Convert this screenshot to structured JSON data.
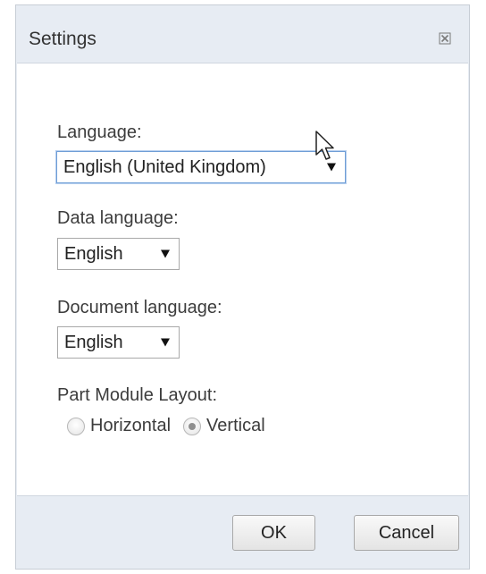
{
  "dialog": {
    "title": "Settings"
  },
  "fields": {
    "language": {
      "label": "Language:",
      "value": "English (United Kingdom)"
    },
    "data_language": {
      "label": "Data language:",
      "value": "English"
    },
    "document_language": {
      "label": "Document language:",
      "value": "English"
    }
  },
  "layout": {
    "label": "Part Module Layout:",
    "options": [
      {
        "label": "Horizontal",
        "selected": false
      },
      {
        "label": "Vertical",
        "selected": true
      }
    ]
  },
  "buttons": {
    "ok": "OK",
    "cancel": "Cancel"
  },
  "colors": {
    "dialog_background": "#e7ecf3",
    "content_background": "#ffffff",
    "focus_border": "#6f9ed6"
  }
}
